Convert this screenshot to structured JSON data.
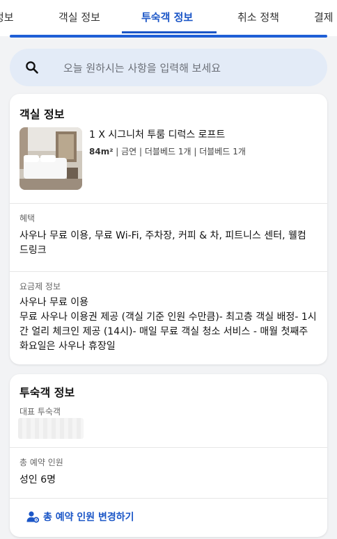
{
  "tabs": [
    {
      "label": "정보"
    },
    {
      "label": "객실 정보"
    },
    {
      "label": "투숙객 정보",
      "active": true
    },
    {
      "label": "취소 정책"
    },
    {
      "label": "결제"
    }
  ],
  "search": {
    "placeholder": "오늘 원하시는 사항을 입력해 보세요",
    "icon": "search-icon"
  },
  "room_card": {
    "title": "객실 정보",
    "room_name": "1 X 시그니처 투룸 디럭스 로프트",
    "area": "84m²",
    "specs": " | 금연 | 더블베드 1개 | 더블베드 1개",
    "benefits_label": "혜택",
    "benefits": "사우나 무료 이용, 무료 Wi-Fi, 주차장, 커피 & 차, 피트니스 센터, 웰컴 드링크",
    "rate_label": "요금제 정보",
    "rate_name": "사우나 무료 이용",
    "rate_details": "무료 사우나 이용권 제공 (객실 기준 인원 수만큼)- 최고층 객실 배정- 1시간 얼리 체크인 제공 (14시)- 매일 무료 객실 청소 서비스 - 매월 첫째주 화요일은 사우나 휴장일"
  },
  "guest_card": {
    "title": "투숙객 정보",
    "lead_guest_label": "대표 투숙객",
    "total_guests_label": "총 예약 인원",
    "total_guests_value": "성인 6명",
    "change_button": "총 예약 인원 변경하기",
    "change_icon": "user-settings-icon"
  },
  "colors": {
    "accent": "#1b56c7",
    "search_bg": "#e3ebf7",
    "page_bg": "#f2f3f5"
  }
}
